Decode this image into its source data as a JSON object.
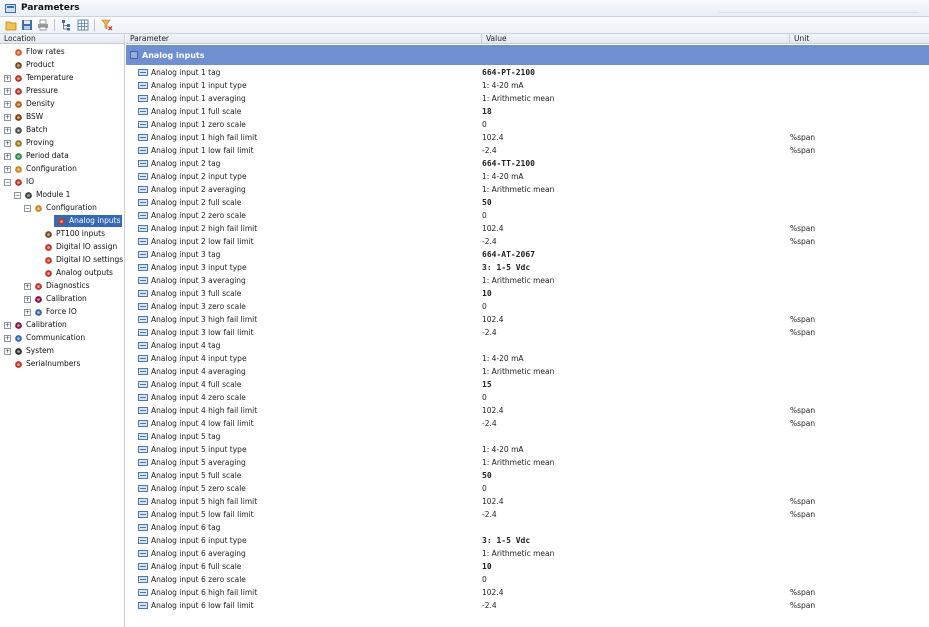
{
  "window": {
    "title": "Parameters"
  },
  "toolbar": {
    "buttons": [
      "open-icon",
      "save-icon",
      "print-icon",
      "tree-icon",
      "grid-icon",
      "filter-icon"
    ]
  },
  "tree": {
    "header": "Location",
    "items": [
      {
        "label": "Flow rates",
        "level": 0,
        "expander": "",
        "icon": "flow-icon",
        "color": "#d0622c"
      },
      {
        "label": "Product",
        "level": 0,
        "expander": "",
        "icon": "drop-icon",
        "color": "#7a4d22"
      },
      {
        "label": "Temperature",
        "level": 0,
        "expander": "+",
        "icon": "thermometer-icon",
        "color": "#c0392b"
      },
      {
        "label": "Pressure",
        "level": 0,
        "expander": "+",
        "icon": "gauge-icon",
        "color": "#b03a2e"
      },
      {
        "label": "Density",
        "level": 0,
        "expander": "+",
        "icon": "density-icon",
        "color": "#b5651d"
      },
      {
        "label": "BSW",
        "level": 0,
        "expander": "+",
        "icon": "bsw-icon",
        "color": "#8b4513"
      },
      {
        "label": "Batch",
        "level": 0,
        "expander": "+",
        "icon": "batch-icon",
        "color": "#555555"
      },
      {
        "label": "Proving",
        "level": 0,
        "expander": "+",
        "icon": "proving-icon",
        "color": "#9a7b1c"
      },
      {
        "label": "Period data",
        "level": 0,
        "expander": "+",
        "icon": "period-icon",
        "color": "#2e8b57"
      },
      {
        "label": "Configuration",
        "level": 0,
        "expander": "+",
        "icon": "config-icon",
        "color": "#c88a1e"
      },
      {
        "label": "IO",
        "level": 0,
        "expander": "−",
        "icon": "io-icon",
        "color": "#c0392b"
      },
      {
        "label": "Module 1",
        "level": 1,
        "expander": "−",
        "icon": "module-icon",
        "color": "#444444"
      },
      {
        "label": "Configuration",
        "level": 2,
        "expander": "−",
        "icon": "config-icon",
        "color": "#c88a1e"
      },
      {
        "label": "Analog inputs",
        "level": 3,
        "expander": "",
        "icon": "analog-icon",
        "color": "#c0392b",
        "selected": true
      },
      {
        "label": "PT100 inputs",
        "level": 3,
        "expander": "",
        "icon": "thermometer-icon",
        "color": "#7a4d22"
      },
      {
        "label": "Digital IO assign",
        "level": 3,
        "expander": "",
        "icon": "digital-icon",
        "color": "#c0392b"
      },
      {
        "label": "Digital IO settings",
        "level": 3,
        "expander": "",
        "icon": "digital-icon",
        "color": "#c0392b"
      },
      {
        "label": "Analog outputs",
        "level": 3,
        "expander": "",
        "icon": "analog-icon",
        "color": "#c0392b"
      },
      {
        "label": "Diagnostics",
        "level": 2,
        "expander": "+",
        "icon": "diagnostics-icon",
        "color": "#c0392b"
      },
      {
        "label": "Calibration",
        "level": 2,
        "expander": "+",
        "icon": "calibration-icon",
        "color": "#8b1a4a"
      },
      {
        "label": "Force IO",
        "level": 2,
        "expander": "+",
        "icon": "wrench-icon",
        "color": "#3d6ca8"
      },
      {
        "label": "Calibration",
        "level": 0,
        "expander": "+",
        "icon": "calibration-icon",
        "color": "#8b1a4a"
      },
      {
        "label": "Communication",
        "level": 0,
        "expander": "+",
        "icon": "network-icon",
        "color": "#3d6ca8"
      },
      {
        "label": "System",
        "level": 0,
        "expander": "+",
        "icon": "gear-icon",
        "color": "#333333"
      },
      {
        "label": "Serialnumbers",
        "level": 0,
        "expander": "",
        "icon": "serial-icon",
        "color": "#c0392b"
      }
    ]
  },
  "grid": {
    "columns": {
      "parameter": "Parameter",
      "value": "Value",
      "unit": "Unit"
    },
    "group": "Analog inputs",
    "rows": [
      {
        "name": "Analog input 1 tag",
        "value": "664-PT-2100",
        "unit": "",
        "bold": true
      },
      {
        "name": "Analog input 1 input type",
        "value": "1: 4-20 mA",
        "unit": ""
      },
      {
        "name": "Analog input 1 averaging",
        "value": "1: Arithmetic mean",
        "unit": ""
      },
      {
        "name": "Analog input 1 full scale",
        "value": "18",
        "unit": "",
        "bold": true
      },
      {
        "name": "Analog input 1 zero scale",
        "value": "0",
        "unit": ""
      },
      {
        "name": "Analog input 1 high fail limit",
        "value": "102.4",
        "unit": "%span"
      },
      {
        "name": "Analog input 1 low fail limit",
        "value": "-2.4",
        "unit": "%span"
      },
      {
        "name": "Analog input 2 tag",
        "value": "664-TT-2100",
        "unit": "",
        "bold": true
      },
      {
        "name": "Analog input 2 input type",
        "value": "1: 4-20 mA",
        "unit": ""
      },
      {
        "name": "Analog input 2 averaging",
        "value": "1: Arithmetic mean",
        "unit": ""
      },
      {
        "name": "Analog input 2 full scale",
        "value": "50",
        "unit": "",
        "bold": true
      },
      {
        "name": "Analog input 2 zero scale",
        "value": "0",
        "unit": ""
      },
      {
        "name": "Analog input 2 high fail limit",
        "value": "102.4",
        "unit": "%span"
      },
      {
        "name": "Analog input 2 low fail limit",
        "value": "-2.4",
        "unit": "%span"
      },
      {
        "name": "Analog input 3 tag",
        "value": "664-AT-2067",
        "unit": "",
        "bold": true
      },
      {
        "name": "Analog input 3 input type",
        "value": "3: 1-5 Vdc",
        "unit": "",
        "bold": true
      },
      {
        "name": "Analog input 3 averaging",
        "value": "1: Arithmetic mean",
        "unit": ""
      },
      {
        "name": "Analog input 3 full scale",
        "value": "10",
        "unit": "",
        "bold": true
      },
      {
        "name": "Analog input 3 zero scale",
        "value": "0",
        "unit": ""
      },
      {
        "name": "Analog input 3 high fail limit",
        "value": "102.4",
        "unit": "%span"
      },
      {
        "name": "Analog input 3 low fail limit",
        "value": "-2.4",
        "unit": "%span"
      },
      {
        "name": "Analog input 4 tag",
        "value": "",
        "unit": ""
      },
      {
        "name": "Analog input 4 input type",
        "value": "1: 4-20 mA",
        "unit": ""
      },
      {
        "name": "Analog input 4 averaging",
        "value": "1: Arithmetic mean",
        "unit": ""
      },
      {
        "name": "Analog input 4 full scale",
        "value": "15",
        "unit": "",
        "bold": true
      },
      {
        "name": "Analog input 4 zero scale",
        "value": "0",
        "unit": ""
      },
      {
        "name": "Analog input 4 high fail limit",
        "value": "102.4",
        "unit": "%span"
      },
      {
        "name": "Analog input 4 low fail limit",
        "value": "-2.4",
        "unit": "%span"
      },
      {
        "name": "Analog input 5 tag",
        "value": "",
        "unit": ""
      },
      {
        "name": "Analog input 5 input type",
        "value": "1: 4-20 mA",
        "unit": ""
      },
      {
        "name": "Analog input 5 averaging",
        "value": "1: Arithmetic mean",
        "unit": ""
      },
      {
        "name": "Analog input 5 full scale",
        "value": "50",
        "unit": "",
        "bold": true
      },
      {
        "name": "Analog input 5 zero scale",
        "value": "0",
        "unit": ""
      },
      {
        "name": "Analog input 5 high fail limit",
        "value": "102.4",
        "unit": "%span"
      },
      {
        "name": "Analog input 5 low fail limit",
        "value": "-2.4",
        "unit": "%span"
      },
      {
        "name": "Analog input 6 tag",
        "value": "",
        "unit": ""
      },
      {
        "name": "Analog input 6 input type",
        "value": "3: 1-5 Vdc",
        "unit": "",
        "bold": true
      },
      {
        "name": "Analog input 6 averaging",
        "value": "1: Arithmetic mean",
        "unit": ""
      },
      {
        "name": "Analog input 6 full scale",
        "value": "10",
        "unit": "",
        "bold": true
      },
      {
        "name": "Analog input 6 zero scale",
        "value": "0",
        "unit": ""
      },
      {
        "name": "Analog input 6 high fail limit",
        "value": "102.4",
        "unit": "%span"
      },
      {
        "name": "Analog input 6 low fail limit",
        "value": "-2.4",
        "unit": "%span"
      }
    ]
  }
}
